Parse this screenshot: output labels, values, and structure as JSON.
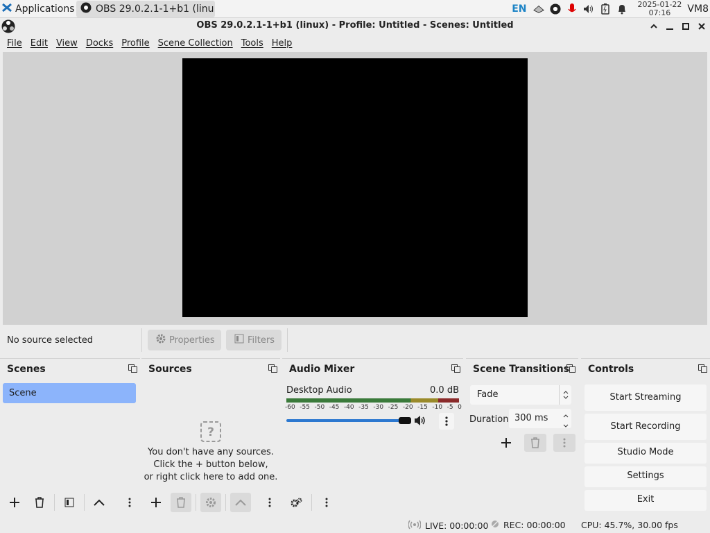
{
  "taskbar": {
    "apps_label": "Applications",
    "window_label": "OBS 29.0.2.1-1+b1 (linu...",
    "lang": "EN",
    "date": "2025-01-22",
    "time": "07:16",
    "vm_label": "VM8"
  },
  "window": {
    "title": "OBS 29.0.2.1-1+b1 (linux) - Profile: Untitled - Scenes: Untitled"
  },
  "menu": [
    "File",
    "Edit",
    "View",
    "Docks",
    "Profile",
    "Scene Collection",
    "Tools",
    "Help"
  ],
  "source_bar": {
    "status": "No source selected",
    "properties": "Properties",
    "filters": "Filters"
  },
  "scenes": {
    "title": "Scenes",
    "items": [
      "Scene"
    ]
  },
  "sources": {
    "title": "Sources",
    "empty_line1": "You don't have any sources.",
    "empty_line2": "Click the + button below,",
    "empty_line3": "or right click here to add one."
  },
  "audio": {
    "title": "Audio Mixer",
    "channel_name": "Desktop Audio",
    "channel_db": "0.0 dB",
    "ticks": [
      "-60",
      "-55",
      "-50",
      "-45",
      "-40",
      "-35",
      "-30",
      "-25",
      "-20",
      "-15",
      "-10",
      "-5",
      "0"
    ],
    "volume_fraction": 1.0
  },
  "transitions": {
    "title": "Scene Transitions",
    "selected": "Fade",
    "duration_label": "Duration",
    "duration_value": "300 ms"
  },
  "controls": {
    "title": "Controls",
    "start_streaming": "Start Streaming",
    "start_recording": "Start Recording",
    "studio_mode": "Studio Mode",
    "settings": "Settings",
    "exit": "Exit"
  },
  "status": {
    "live": "LIVE: 00:00:00",
    "rec": "REC: 00:00:00",
    "cpu": "CPU: 45.7%, 30.00 fps"
  },
  "colors": {
    "selected_scene": "#8cb4fb",
    "volume_track": "#2c78d0"
  }
}
